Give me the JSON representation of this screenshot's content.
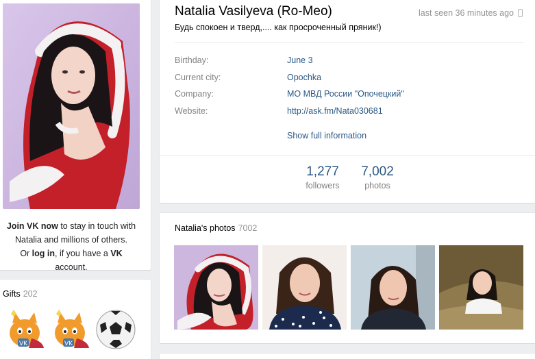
{
  "left": {
    "join": {
      "join_bold": "Join VK now",
      "join_rest": " to stay in touch with",
      "line2": "Natalia and millions of others.",
      "or": "Or ",
      "login": "log in",
      "if_you_have": ", if you have a ",
      "vk": "VK",
      "account": " account."
    },
    "gifts": {
      "title": "Gifts",
      "count": "202",
      "items": [
        "cat-gift-icon",
        "cat-gift-icon",
        "soccer-ball-icon"
      ]
    }
  },
  "profile": {
    "name": "Natalia Vasilyeva (Ro-Meo)",
    "last_seen": "last seen 36 minutes ago",
    "status": "Будь спокоен и тверд,.... как просроченный пряник!)",
    "info": [
      {
        "label": "Birthday:",
        "value": "June 3"
      },
      {
        "label": "Current city:",
        "value": "Opochka"
      },
      {
        "label": "Company:",
        "value": "МО МВД России \"Опочецкий\""
      },
      {
        "label": "Website:",
        "value": "http://ask.fm/Nata030681"
      }
    ],
    "show_full": "Show full information",
    "counters": [
      {
        "value": "1,277",
        "label": "followers"
      },
      {
        "value": "7,002",
        "label": "photos"
      }
    ]
  },
  "photos": {
    "title": "Natalia's photos",
    "count": "7002"
  },
  "colors": {
    "link": "#2a5885",
    "muted": "#828282",
    "background": "#edeef0"
  }
}
